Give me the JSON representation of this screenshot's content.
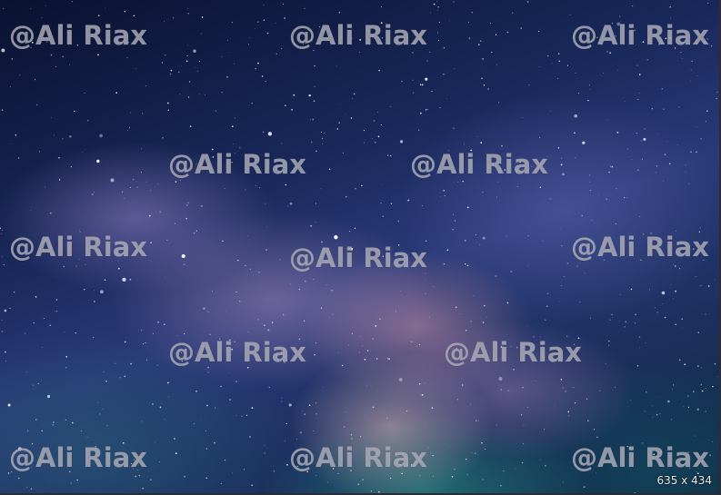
{
  "image": {
    "subject": "starry night sky",
    "watermark_text": "@Ali Riax",
    "dimensions_text": "635 x 434"
  },
  "colors": {
    "sky_deep": "#0a1230",
    "sky_mid": "#2a3a78",
    "nebula_pink": "#d296aa",
    "nebula_teal": "#28a08c"
  }
}
